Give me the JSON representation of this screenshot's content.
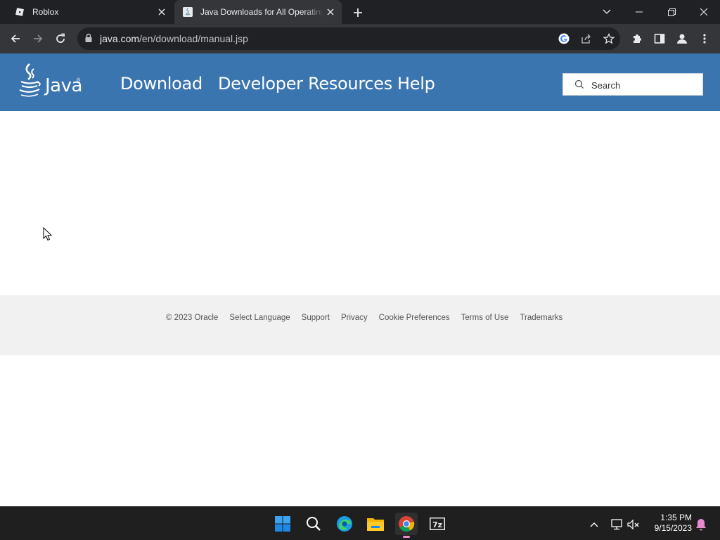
{
  "browser": {
    "tabs": [
      {
        "title": "Roblox",
        "favicon": "roblox-icon",
        "active": false
      },
      {
        "title": "Java Downloads for All Operating Systems",
        "favicon": "java-icon",
        "active": true
      }
    ],
    "url_host": "java.com",
    "url_path": "/en/download/manual.jsp"
  },
  "site": {
    "logo_text": "Java",
    "logo_tm": "®",
    "nav": [
      "Download",
      "Developer Resources",
      "Help"
    ],
    "search_placeholder": "Search"
  },
  "footer": {
    "links": [
      "© 2023 Oracle",
      "Select Language",
      "Support",
      "Privacy",
      "Cookie Preferences",
      "Terms of Use",
      "Trademarks"
    ]
  },
  "taskbar": {
    "time": "1:35 PM",
    "date": "9/15/2023"
  },
  "colors": {
    "header_blue": "#3a75b0",
    "footer_bg": "#f1f1f1",
    "chrome_dark": "#202124"
  }
}
